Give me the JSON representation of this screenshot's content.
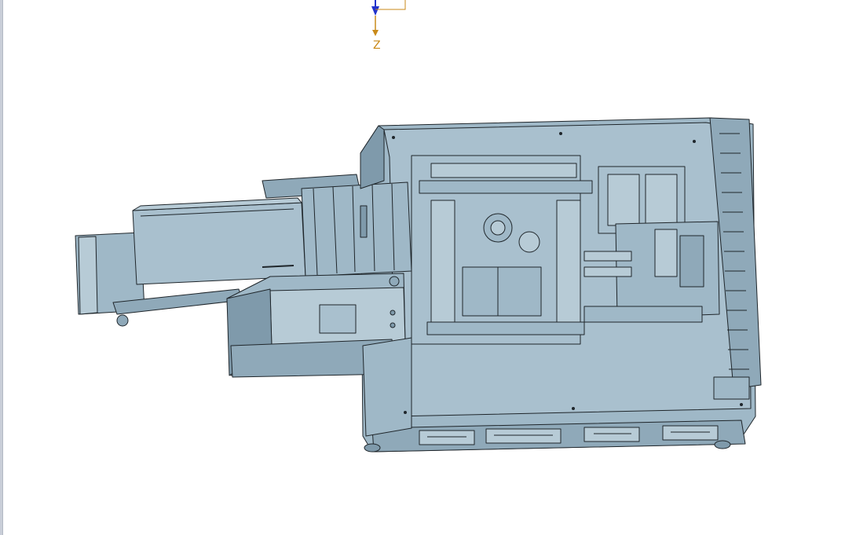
{
  "viewport": {
    "background": "#ffffff",
    "model_fill": "#9fb8c7",
    "model_fill_light": "#b7cbd6",
    "model_fill_dark": "#7f9aab",
    "edge_color": "#1f262b"
  },
  "triad": {
    "axis_label": "Z",
    "axis_color": "#c98a1a",
    "arrow_color": "#2233cc"
  }
}
